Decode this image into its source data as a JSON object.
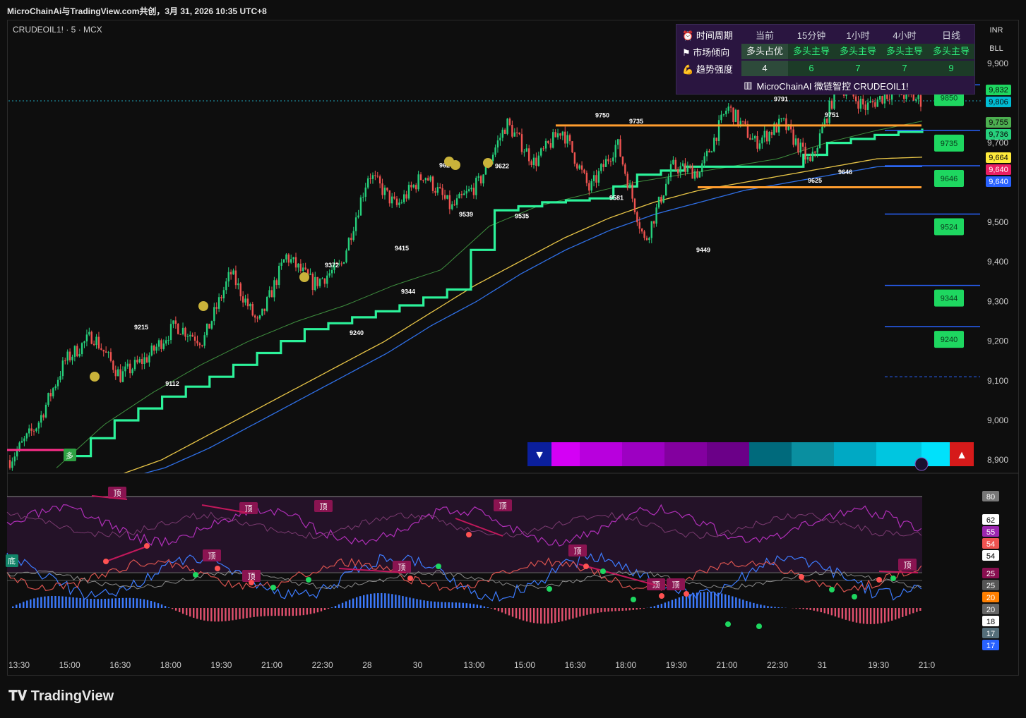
{
  "window": {
    "title": "MicroChainAi与TradingView.com共创，3月 31, 2026 10:35 UTC+8",
    "symbol": "CRUDEOIL1! · 5 · MCX",
    "brand": "TradingView",
    "currency": "INR",
    "unit": "BLL"
  },
  "table": {
    "headers": [
      "时间周期",
      "当前",
      "15分钟",
      "1小时",
      "4小时",
      "日线"
    ],
    "rows": [
      {
        "label": "市场倾向",
        "values": [
          "多头占优",
          "多头主导",
          "多头主导",
          "多头主导",
          "多头主导"
        ]
      },
      {
        "label": "趋势强度",
        "values": [
          "4",
          "6",
          "7",
          "7",
          "9"
        ]
      }
    ],
    "footer": "MicroChainAI 微链智控 CRUDEOIL1!",
    "icons": [
      "alarm-clock-icon",
      "flag-icon",
      "flexed-arm-icon",
      "chart-icon"
    ]
  },
  "colors": {
    "bull": "#26d07c",
    "bear": "#ef5350",
    "trail": "#2cf29a",
    "ema_yellow": "#e8c547",
    "ema_blue": "#2f6fe6",
    "sr": "#ff9d2e",
    "osc_purple": "#b02fb8"
  },
  "chart_data": [
    {
      "type": "line",
      "title": "",
      "xlabel": "",
      "ylabel": "",
      "x_ticks": [
        "13:30",
        "15:00",
        "16:30",
        "18:00",
        "19:30",
        "21:00",
        "22:30",
        "28",
        "30",
        "13:00",
        "15:00",
        "16:30",
        "18:00",
        "19:30",
        "21:00",
        "22:30",
        "31",
        "19:30",
        "21:0"
      ],
      "y_ticks": [
        8900,
        9000,
        9100,
        9200,
        9300,
        9400,
        9500,
        9600,
        9700,
        9800,
        9900
      ],
      "ylim": [
        8890,
        9930
      ],
      "price_path": [
        8900,
        8990,
        9150,
        9215,
        9112,
        9160,
        9240,
        9200,
        9372,
        9240,
        9415,
        9344,
        9390,
        9624,
        9539,
        9622,
        9535,
        9600,
        9750,
        9650,
        9735,
        9581,
        9700,
        9449,
        9640,
        9625,
        9791,
        9700,
        9751,
        9646,
        9850,
        9790,
        9832,
        9806
      ],
      "trail_stop": [
        8910,
        9000,
        9060,
        9110,
        9170,
        9230,
        9260,
        9290,
        9330,
        9530,
        9550,
        9560,
        9620,
        9640,
        9640,
        9640,
        9700,
        9720,
        9736
      ],
      "ema_fast": [
        8880,
        8990,
        9070,
        9140,
        9200,
        9250,
        9290,
        9340,
        9380,
        9490,
        9540,
        9570,
        9600,
        9620,
        9640,
        9660,
        9700,
        9730,
        9755
      ],
      "ema_mid": [
        8860,
        8900,
        8960,
        9020,
        9080,
        9140,
        9200,
        9270,
        9340,
        9400,
        9460,
        9510,
        9550,
        9580,
        9600,
        9620,
        9640,
        9660,
        9664
      ],
      "ema_slow": [
        8850,
        8880,
        8930,
        8990,
        9050,
        9110,
        9170,
        9240,
        9300,
        9370,
        9430,
        9480,
        9520,
        9550,
        9580,
        9600,
        9620,
        9640,
        9640
      ],
      "swing_labels": [
        {
          "text": "9215",
          "value": 9215
        },
        {
          "text": "9112",
          "value": 9112
        },
        {
          "text": "9372",
          "value": 9372
        },
        {
          "text": "9240",
          "value": 9240
        },
        {
          "text": "9415",
          "value": 9415
        },
        {
          "text": "9344",
          "value": 9344
        },
        {
          "text": "9624",
          "value": 9624
        },
        {
          "text": "9539",
          "value": 9539
        },
        {
          "text": "9622",
          "value": 9622
        },
        {
          "text": "9535",
          "value": 9535
        },
        {
          "text": "9750",
          "value": 9750
        },
        {
          "text": "9735",
          "value": 9735
        },
        {
          "text": "9581",
          "value": 9581
        },
        {
          "text": "9449",
          "value": 9449
        },
        {
          "text": "9625",
          "value": 9625
        },
        {
          "text": "9791",
          "value": 9791
        },
        {
          "text": "9751",
          "value": 9751
        },
        {
          "text": "9646",
          "value": 9646
        },
        {
          "text": "9850",
          "value": 9850
        }
      ],
      "resistance": 9735,
      "support": 9581,
      "level_buttons": [
        "9850",
        "9735",
        "9646",
        "9524",
        "9344",
        "9240"
      ],
      "price_badges": [
        {
          "text": "9,832",
          "color": "#1ed760",
          "value": 9832
        },
        {
          "text": "9,806",
          "color": "#00bcd4",
          "value": 9806
        },
        {
          "text": "9,755",
          "color": "#4caf50",
          "value": 9755
        },
        {
          "text": "9,736",
          "color": "#26d07c",
          "value": 9736
        },
        {
          "text": "9,664",
          "color": "#ffeb3b",
          "value": 9664
        },
        {
          "text": "9,640",
          "color": "#e91e63",
          "value": 9640
        },
        {
          "text": "9,640",
          "color": "#2962ff",
          "value": 9640
        }
      ],
      "signal": "多"
    },
    {
      "type": "line",
      "title": "",
      "top_label": "顶",
      "bottom_label": "底",
      "scale_badges": [
        {
          "text": "80",
          "color": "#777777"
        },
        {
          "text": "62",
          "color": "#ffffff"
        },
        {
          "text": "55",
          "color": "#9c27b0"
        },
        {
          "text": "54",
          "color": "#ef5350"
        },
        {
          "text": "54",
          "color": "#ffffff"
        },
        {
          "text": "25",
          "color": "#880e4f"
        },
        {
          "text": "25",
          "color": "#555555"
        },
        {
          "text": "20",
          "color": "#ff7f00"
        },
        {
          "text": "20",
          "color": "#666666"
        },
        {
          "text": "18",
          "color": "#ffffff"
        },
        {
          "text": "17",
          "color": "#546e7a"
        },
        {
          "text": "17",
          "color": "#2962ff"
        }
      ]
    }
  ]
}
